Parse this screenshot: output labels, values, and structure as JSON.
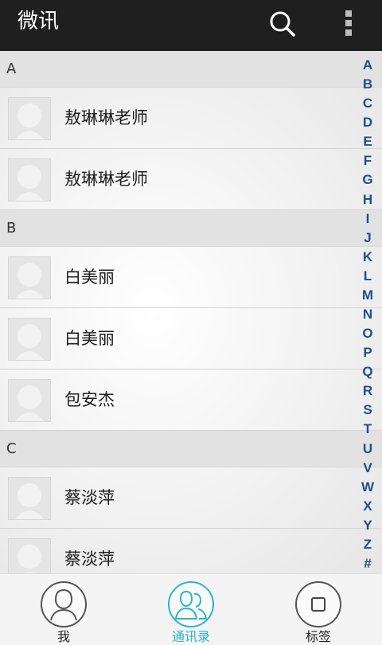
{
  "app_bar": {
    "title": "微讯",
    "search_icon": "search-icon",
    "menu_icon": "more-vert-icon",
    "background": "#1f1f1f"
  },
  "sections": [
    {
      "letter": "A",
      "contacts": [
        {
          "name": "敖琳琳老师"
        },
        {
          "name": "敖琳琳老师"
        }
      ]
    },
    {
      "letter": "B",
      "contacts": [
        {
          "name": "白美丽"
        },
        {
          "name": "白美丽"
        },
        {
          "name": "包安杰"
        }
      ]
    },
    {
      "letter": "C",
      "contacts": [
        {
          "name": "蔡淡萍"
        },
        {
          "name": "蔡淡萍"
        }
      ]
    }
  ],
  "alpha_index": [
    "A",
    "B",
    "C",
    "D",
    "E",
    "F",
    "G",
    "H",
    "I",
    "J",
    "K",
    "L",
    "M",
    "N",
    "O",
    "P",
    "Q",
    "R",
    "S",
    "T",
    "U",
    "V",
    "W",
    "X",
    "Y",
    "Z",
    "#"
  ],
  "bottom_nav": {
    "items": [
      {
        "label": "我",
        "icon": "person-icon",
        "active": false
      },
      {
        "label": "通讯录",
        "icon": "contacts-icon",
        "active": true
      },
      {
        "label": "标签",
        "icon": "tag-square-icon",
        "active": false
      }
    ],
    "accent_color": "#2ab6c8"
  }
}
